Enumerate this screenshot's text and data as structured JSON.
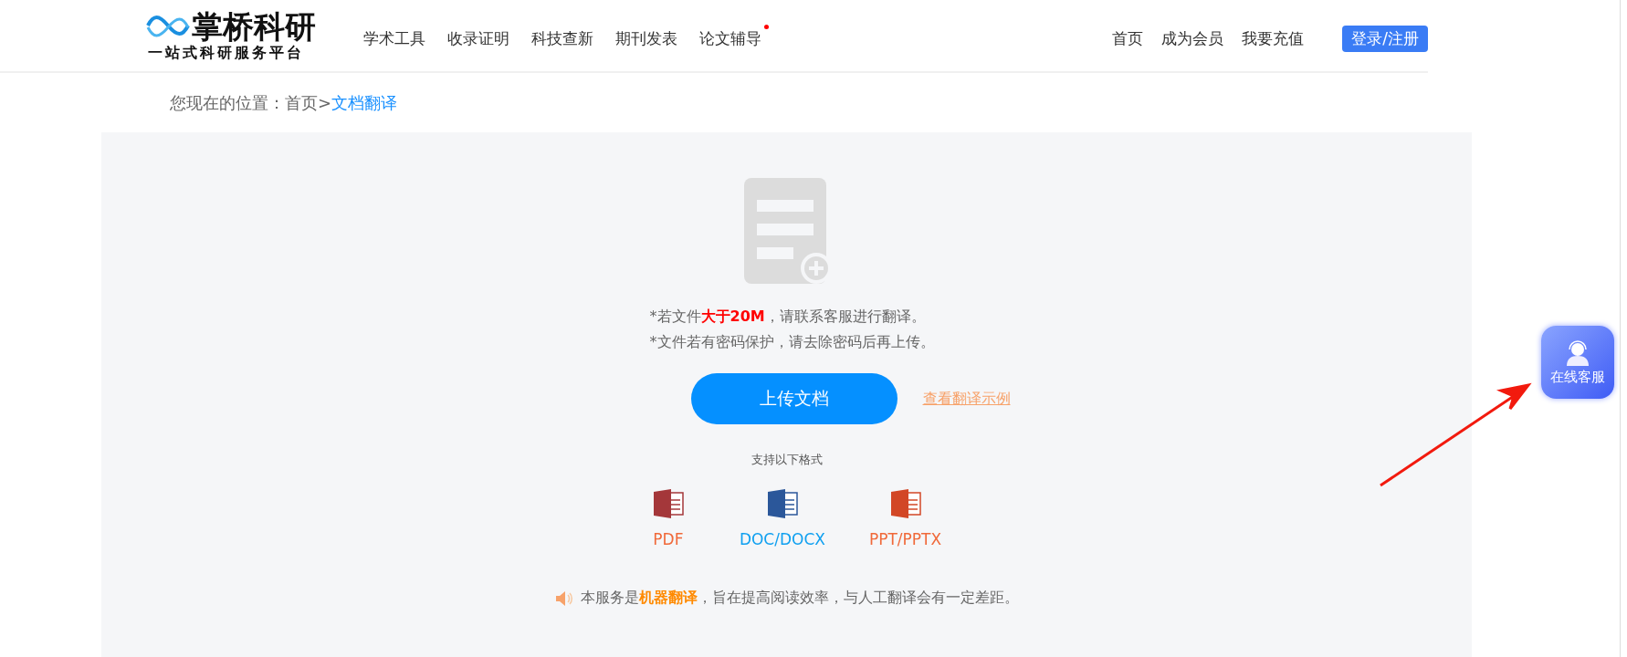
{
  "header": {
    "logo": {
      "title": "掌桥科研",
      "subtitle": "一站式科研服务平台"
    },
    "nav": [
      {
        "label": "学术工具",
        "dot": false
      },
      {
        "label": "收录证明",
        "dot": false
      },
      {
        "label": "科技查新",
        "dot": false
      },
      {
        "label": "期刊发表",
        "dot": false
      },
      {
        "label": "论文辅导",
        "dot": true
      }
    ],
    "links": [
      "首页",
      "成为会员",
      "我要充值"
    ],
    "login_button": "登录/注册"
  },
  "breadcrumb": {
    "prefix": "您现在的位置：",
    "items": [
      {
        "label": "首页",
        "current": false
      },
      {
        "label": "文档翻译",
        "current": true
      }
    ],
    "separator": ">"
  },
  "upload": {
    "notes": [
      "*若文件**大于20M**，请联系客服进行翻译。",
      "*文件若有密码保护，请去除密码后再上传。"
    ],
    "button": "上传文档",
    "example_link": "查看翻译示例",
    "formats_title": "支持以下格式",
    "formats": [
      {
        "kind": "pdf",
        "label": "PDF",
        "color": "#f0693a"
      },
      {
        "kind": "word",
        "label": "DOC/DOCX",
        "color": "#10a0f0"
      },
      {
        "kind": "ppt",
        "label": "PPT/PPTX",
        "color": "#f0693a"
      }
    ],
    "notice": "本服务是**机器翻译**，旨在提高阅读效率，与人工翻译会有一定差距。"
  },
  "float_service": {
    "label": "在线客服"
  }
}
